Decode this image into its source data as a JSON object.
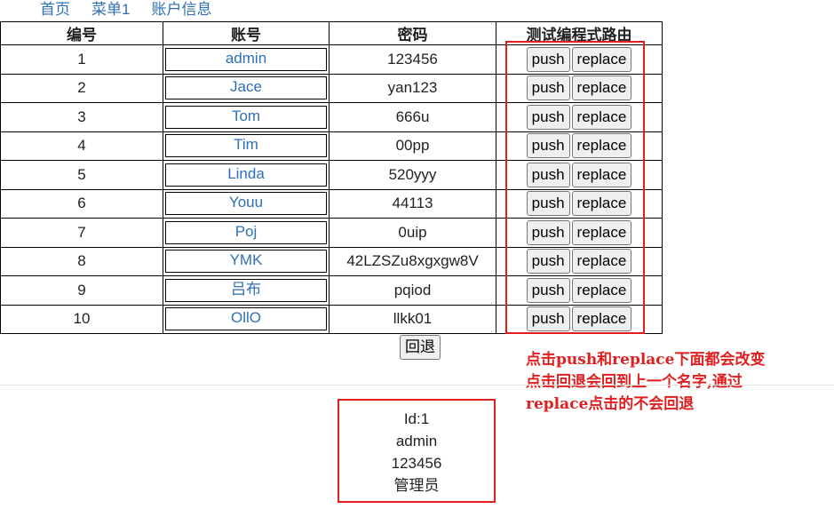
{
  "nav": {
    "home": "首页",
    "menu1": "菜单1",
    "account_info": "账户信息"
  },
  "table": {
    "headers": [
      "编号",
      "账号",
      "密码",
      "测试编程式路由"
    ],
    "rows": [
      {
        "id": "1",
        "account": "admin",
        "password": "123456"
      },
      {
        "id": "2",
        "account": "Jace",
        "password": "yan123"
      },
      {
        "id": "3",
        "account": "Tom",
        "password": "666u"
      },
      {
        "id": "4",
        "account": "Tim",
        "password": "00pp"
      },
      {
        "id": "5",
        "account": "Linda",
        "password": "520yyy"
      },
      {
        "id": "6",
        "account": "Youu",
        "password": "44113"
      },
      {
        "id": "7",
        "account": "Poj",
        "password": "0uip"
      },
      {
        "id": "8",
        "account": "YMK",
        "password": "42LZSZu8xgxgw8V"
      },
      {
        "id": "9",
        "account": "吕布",
        "password": "pqiod"
      },
      {
        "id": "10",
        "account": "OllO",
        "password": "llkk01"
      }
    ],
    "push_label": "push",
    "replace_label": "replace"
  },
  "back_button": "回退",
  "annotation": {
    "line1": "点击push和replace下面都会改变",
    "line2": "点击回退会回到上一个名字,通过",
    "line3": "replace点击的不会回退"
  },
  "detail": {
    "id_line": "Id:1",
    "account": "admin",
    "password": "123456",
    "role": "管理员"
  },
  "colors": {
    "link": "#2f6fb6",
    "annotation_red": "#e02020"
  }
}
